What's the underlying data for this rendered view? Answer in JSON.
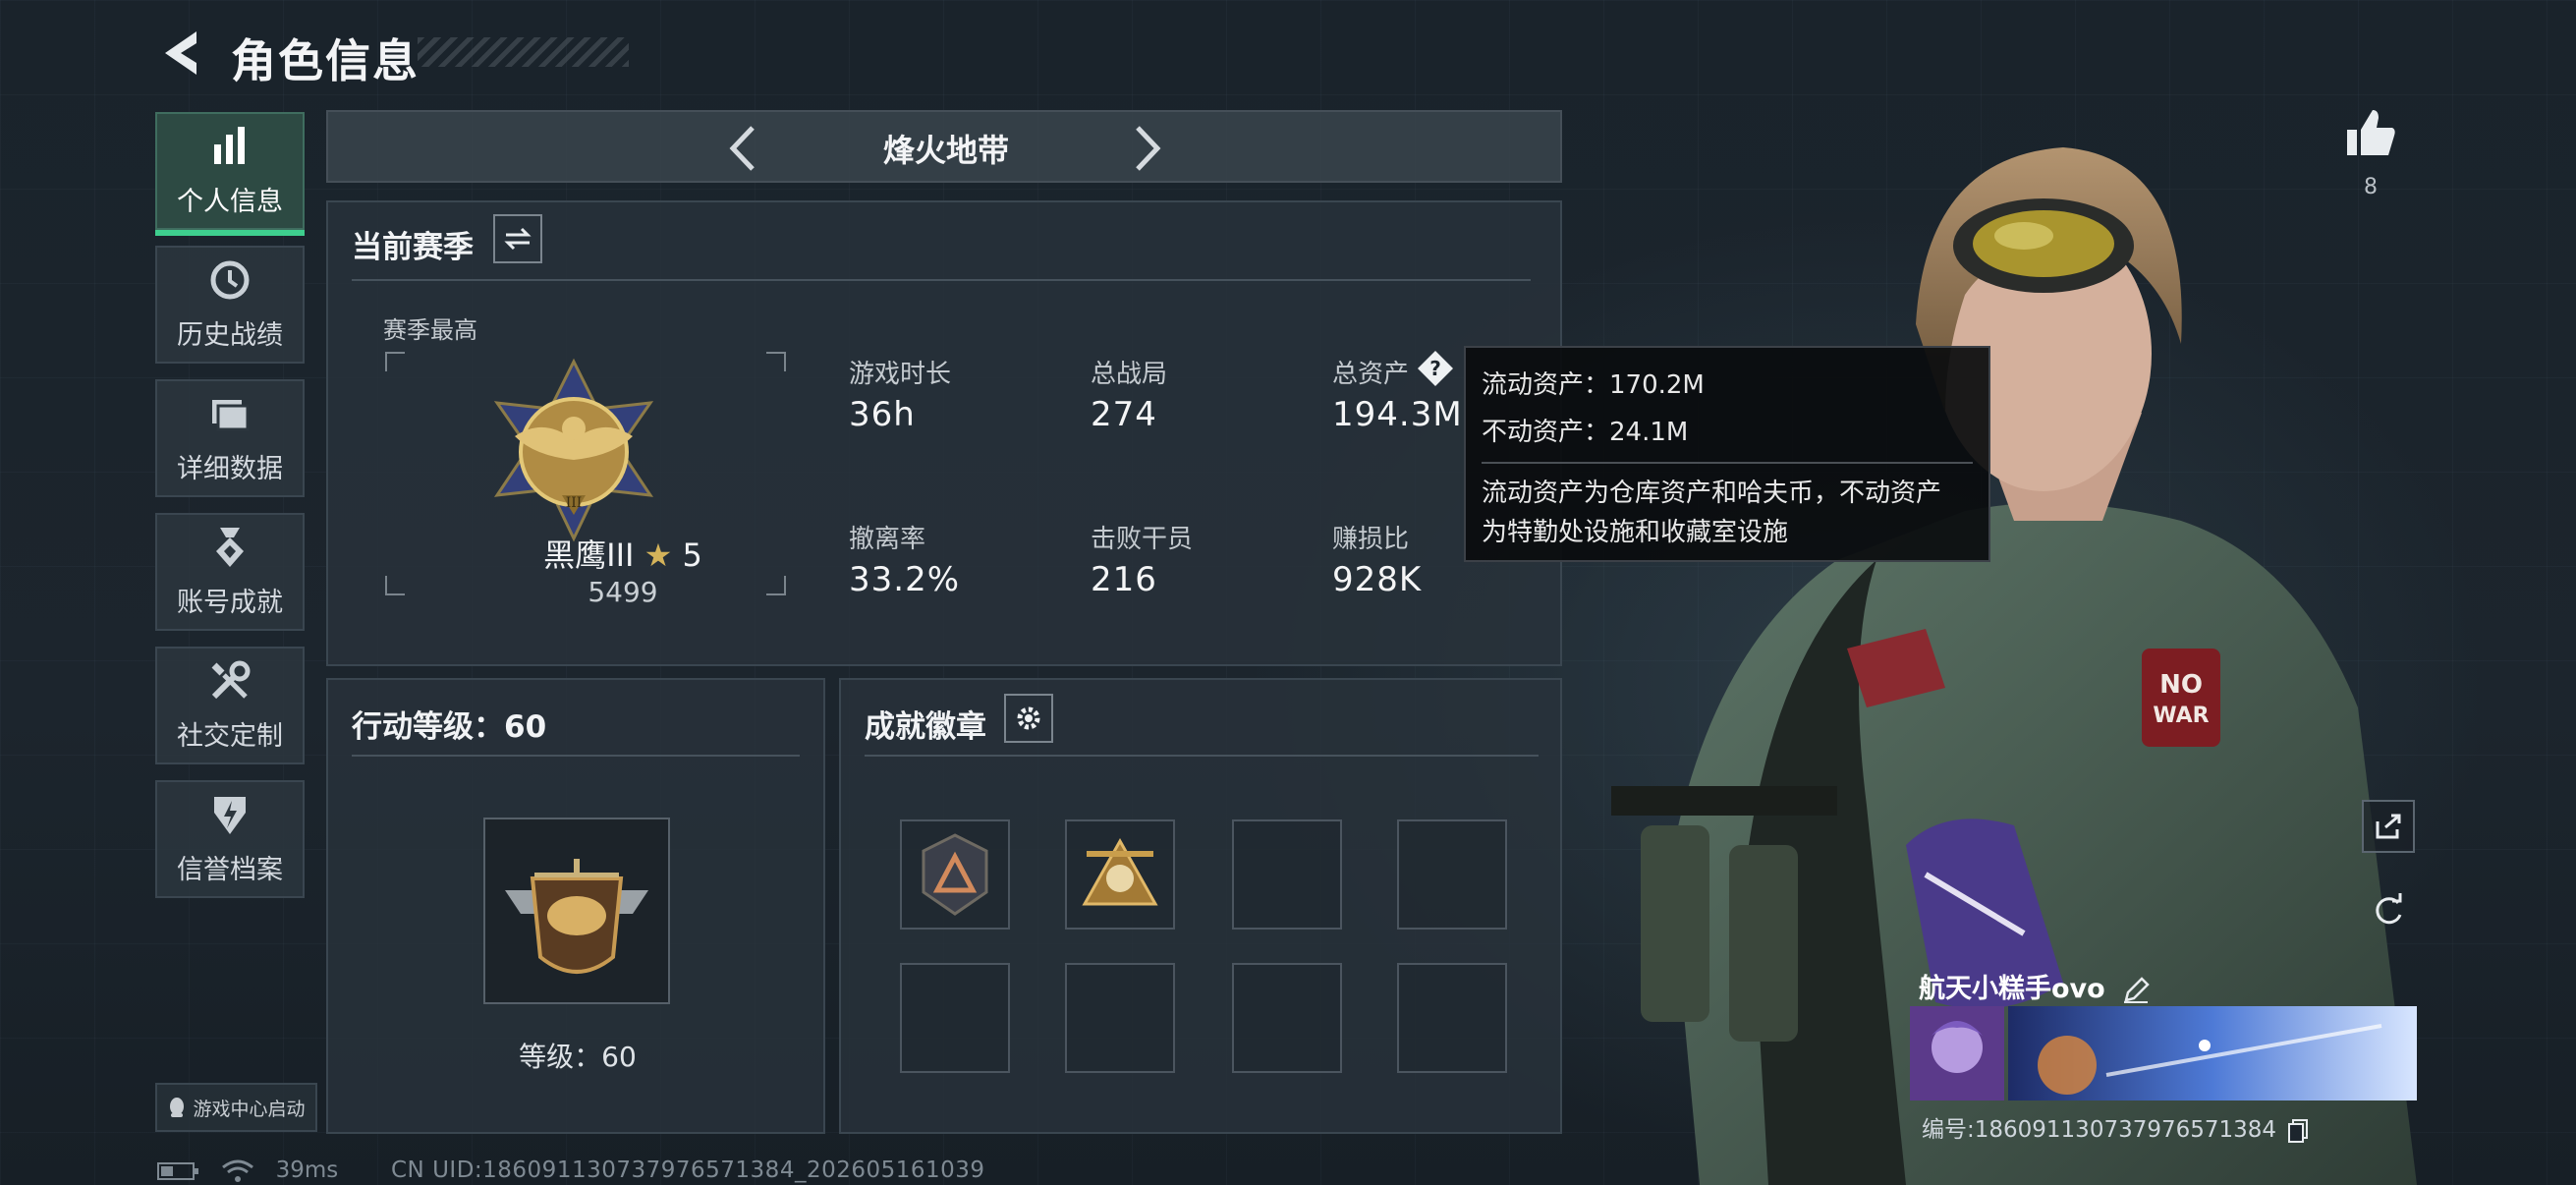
{
  "header": {
    "title": "角色信息",
    "back_icon": "back-arrow-icon"
  },
  "sidebar": {
    "items": [
      {
        "label": "个人信息",
        "icon": "bar-chart-icon",
        "active": true
      },
      {
        "label": "历史战绩",
        "icon": "history-clock-icon",
        "active": false
      },
      {
        "label": "详细数据",
        "icon": "folder-icon",
        "active": false
      },
      {
        "label": "账号成就",
        "icon": "medal-icon",
        "active": false
      },
      {
        "label": "社交定制",
        "icon": "tools-icon",
        "active": false
      },
      {
        "label": "信誉档案",
        "icon": "shield-bolt-icon",
        "active": false
      }
    ],
    "launch_label": "游戏中心启动"
  },
  "mode_selector": {
    "name": "烽火地带"
  },
  "season": {
    "title": "当前赛季",
    "best_label": "赛季最高",
    "rank_name": "黑鹰III",
    "rank_stars": "5",
    "rank_score": "5499",
    "stats": [
      {
        "label": "游戏时长",
        "value": "36h"
      },
      {
        "label": "总战局",
        "value": "274"
      },
      {
        "label": "总资产",
        "value": "194.3M"
      },
      {
        "label": "撤离率",
        "value": "33.2%"
      },
      {
        "label": "击败干员",
        "value": "216"
      },
      {
        "label": "赚损比",
        "value": "928K"
      }
    ]
  },
  "tooltip": {
    "liquid": "流动资产：170.2M",
    "fixed": "不动资产：24.1M",
    "desc_line1": "流动资产为仓库资产和哈夫币，不动资产",
    "desc_line2": "为特勤处设施和收藏室设施"
  },
  "action_level": {
    "title": "行动等级：60",
    "level_label": "等级：60"
  },
  "achievements": {
    "title": "成就徽章",
    "slots_filled": 2,
    "slots_total": 8
  },
  "likes": {
    "count": "8"
  },
  "player": {
    "name": "航天小糕手ovo",
    "uid_line": "编号:186091130737976571384"
  },
  "status_bar": {
    "ping": "39ms",
    "uid_footer": "CN UID:186091130737976571384_202605161039"
  },
  "colors": {
    "accent": "#3ecf8e",
    "panel": "#28323a",
    "gold": "#c9a24a"
  }
}
